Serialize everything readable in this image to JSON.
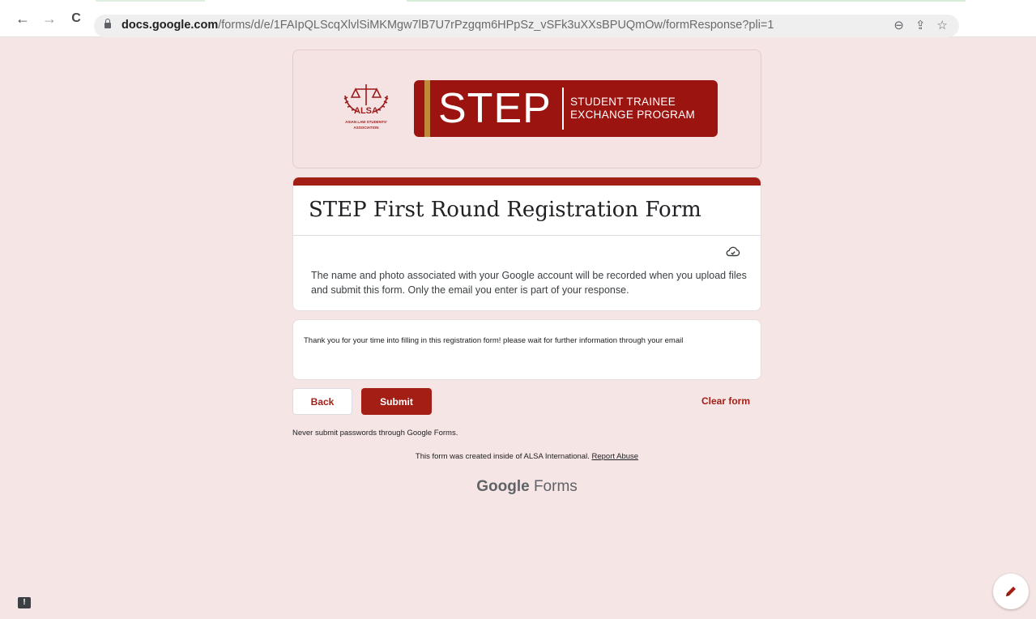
{
  "browser": {
    "back_icon": "←",
    "forward_icon": "→",
    "reload_icon": "C",
    "url_host": "docs.google.com",
    "url_path": "/forms/d/e/1FAIpQLScqXlvlSiMKMgw7lB7U7rPzgqm6HPpSz_vSFk3uXXsBPUQmOw/formResponse?pli=1",
    "zoom_icon": "⊖",
    "share_icon": "⇪",
    "star_icon": "☆"
  },
  "header": {
    "logo_text": "ALSA",
    "logo_subtext_1": "ASIAN LAW STUDENTS'",
    "logo_subtext_2": "ASSOCIATION",
    "banner_word": "STEP",
    "banner_sub_1": "STUDENT TRAINEE",
    "banner_sub_2": "EXCHANGE PROGRAM"
  },
  "form": {
    "title": "STEP First Round Registration Form",
    "notice": "The name and photo associated with your Google account will be recorded when you upload files and submit this form. Only the email you enter is part of your response.",
    "confirmation": "Thank you for your time into filling in this registration form! please wait for further information through your email",
    "back_label": "Back",
    "submit_label": "Submit",
    "clear_label": "Clear form",
    "never_submit": "Never submit passwords through Google Forms.",
    "created_text": "This form was created inside of ALSA International.",
    "report_abuse": "Report Abuse",
    "brand_google": "Google",
    "brand_forms": "Forms"
  },
  "colors": {
    "accent": "#a31f16",
    "page_bg": "#f6e5e5",
    "banner": "#9c1410",
    "gold": "#c08a3d"
  }
}
